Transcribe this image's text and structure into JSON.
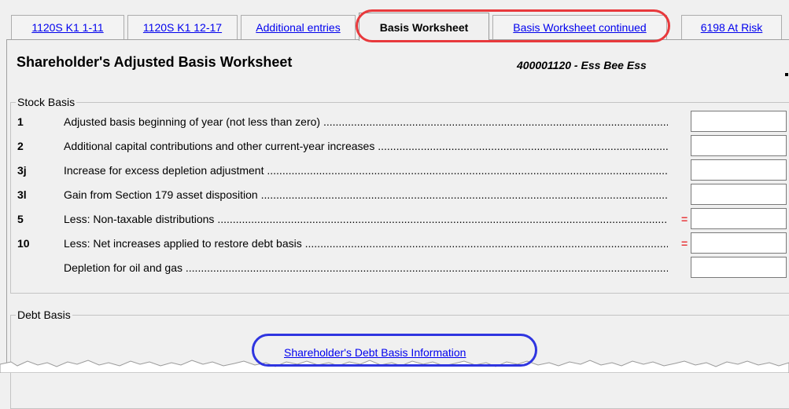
{
  "tabs": [
    {
      "label": "1120S K1 1-11",
      "active": false
    },
    {
      "label": "1120S K1 12-17",
      "active": false
    },
    {
      "label": "Additional entries",
      "active": false
    },
    {
      "label": "Basis Worksheet",
      "active": true
    },
    {
      "label": "Basis Worksheet continued",
      "active": false
    },
    {
      "label": "6198 At Risk",
      "active": false
    }
  ],
  "header": {
    "title": "Shareholder's Adjusted Basis Worksheet",
    "entity": "400001120 - Ess Bee Ess"
  },
  "stock_basis": {
    "legend": "Stock Basis",
    "rows": [
      {
        "num": "1",
        "label": "Adjusted basis beginning of year (not less than zero)",
        "marker": "",
        "value": ""
      },
      {
        "num": "2",
        "label": "Additional capital contributions and other current-year increases",
        "marker": "",
        "value": ""
      },
      {
        "num": "3j",
        "label": "Increase for excess depletion adjustment",
        "marker": "",
        "value": ""
      },
      {
        "num": "3l",
        "label": "Gain from Section 179 asset disposition",
        "marker": "",
        "value": ""
      },
      {
        "num": "5",
        "label": "Less: Non-taxable distributions",
        "marker": "=",
        "value": ""
      },
      {
        "num": "10",
        "label": "Less: Net increases applied to restore debt basis",
        "marker": "=",
        "value": ""
      },
      {
        "num": "",
        "label": "Depletion for oil and gas",
        "marker": "",
        "value": ""
      }
    ]
  },
  "debt_basis": {
    "legend": "Debt Basis",
    "link": "Shareholder's Debt Basis Information"
  },
  "colors": {
    "link": "#0000ee",
    "annotation_red": "#e8393c",
    "annotation_blue": "#2f35e0",
    "panel_bg": "#f0f0f0"
  }
}
